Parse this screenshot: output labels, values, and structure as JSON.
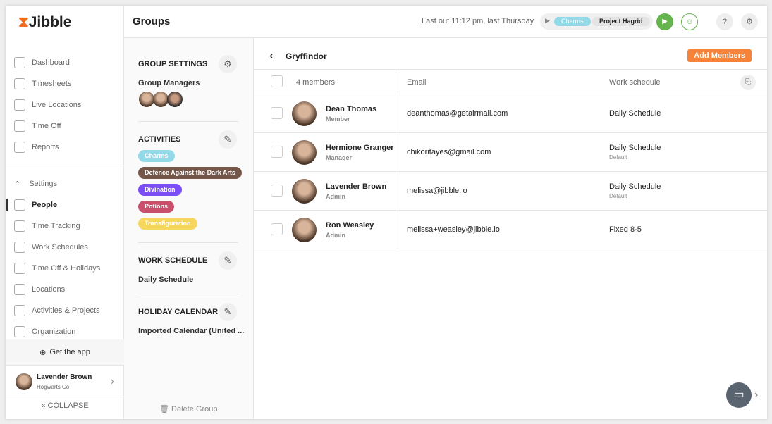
{
  "logo": "Jibble",
  "sidebar": {
    "items": [
      {
        "label": "Dashboard"
      },
      {
        "label": "Timesheets"
      },
      {
        "label": "Live Locations"
      },
      {
        "label": "Time Off"
      },
      {
        "label": "Reports"
      }
    ],
    "settings_label": "Settings",
    "settings_items": [
      {
        "label": "People",
        "active": true
      },
      {
        "label": "Time Tracking"
      },
      {
        "label": "Work Schedules"
      },
      {
        "label": "Time Off & Holidays"
      },
      {
        "label": "Locations"
      },
      {
        "label": "Activities & Projects"
      },
      {
        "label": "Organization"
      }
    ],
    "get_app": "Get the app",
    "user_name": "Lavender Brown",
    "user_org": "Hogwarts Co",
    "collapse": "COLLAPSE"
  },
  "header": {
    "title": "Groups",
    "last_out": "Last out 11:12 pm, last Thursday",
    "activity": "Charms",
    "project": "Project Hagrid"
  },
  "group_settings": {
    "title": "GROUP SETTINGS",
    "managers_label": "Group Managers",
    "activities_title": "ACTIVITIES",
    "activities": [
      {
        "label": "Charms",
        "color": "#93d9e8"
      },
      {
        "label": "Defence Against the Dark Arts",
        "color": "#75574a"
      },
      {
        "label": "Divination",
        "color": "#7b4ff5"
      },
      {
        "label": "Potions",
        "color": "#c9506c"
      },
      {
        "label": "Transfiguration",
        "color": "#f7d660"
      }
    ],
    "work_schedule_title": "WORK SCHEDULE",
    "work_schedule": "Daily Schedule",
    "holiday_title": "HOLIDAY CALENDAR",
    "holiday": "Imported Calendar (United ...",
    "delete": "Delete Group"
  },
  "group": {
    "name": "Gryffindor",
    "add_members": "Add Members",
    "accent": "#f5833a",
    "columns": {
      "members": "4 members",
      "email": "Email",
      "schedule": "Work schedule"
    },
    "members": [
      {
        "name": "Dean Thomas",
        "role": "Member",
        "email": "deanthomas@getairmail.com",
        "schedule": "Daily Schedule",
        "note": ""
      },
      {
        "name": "Hermione Granger",
        "role": "Manager",
        "email": "chikoritayes@gmail.com",
        "schedule": "Daily Schedule",
        "note": "Default"
      },
      {
        "name": "Lavender Brown",
        "role": "Admin",
        "email": "melissa@jibble.io",
        "schedule": "Daily Schedule",
        "note": "Default"
      },
      {
        "name": "Ron Weasley",
        "role": "Admin",
        "email": "melissa+weasley@jibble.io",
        "schedule": "Fixed 8-5",
        "note": ""
      }
    ]
  }
}
